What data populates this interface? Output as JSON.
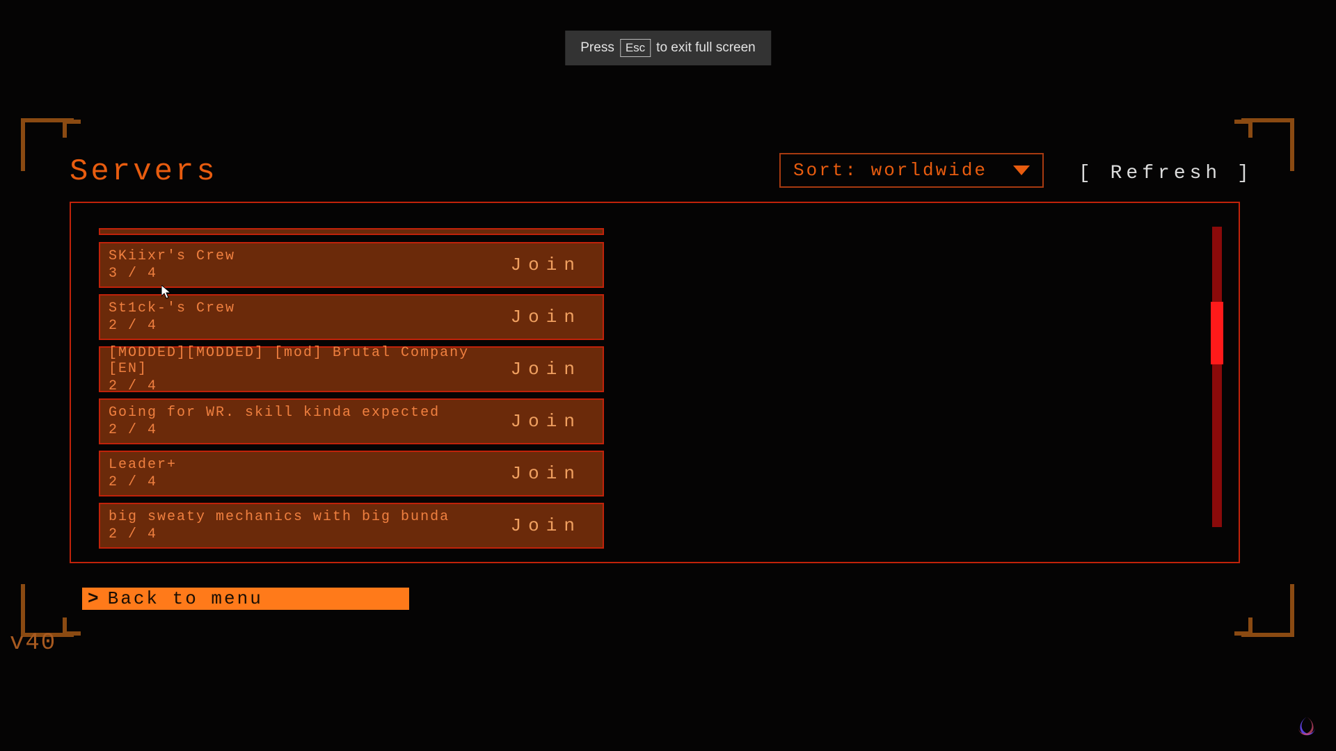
{
  "hint": {
    "pre": "Press",
    "key": "Esc",
    "post": "to exit full screen"
  },
  "title": "Servers",
  "sort": {
    "label": "Sort: worldwide"
  },
  "refresh": "[ Refresh ]",
  "servers": [
    {
      "name": "SKiixr's Crew",
      "count": "3 / 4",
      "join": "Join"
    },
    {
      "name": "St1ck-'s Crew",
      "count": "2 / 4",
      "join": "Join"
    },
    {
      "name": "[MODDED][MODDED] [mod] Brutal Company [EN]",
      "count": "2 / 4",
      "join": "Join"
    },
    {
      "name": "Going for WR. skill kinda expected",
      "count": "2 / 4",
      "join": "Join"
    },
    {
      "name": "Leader+",
      "count": "2 / 4",
      "join": "Join"
    },
    {
      "name": "big sweaty mechanics with big bunda",
      "count": "2 / 4",
      "join": "Join"
    }
  ],
  "back": "Back to menu",
  "version": "v40"
}
